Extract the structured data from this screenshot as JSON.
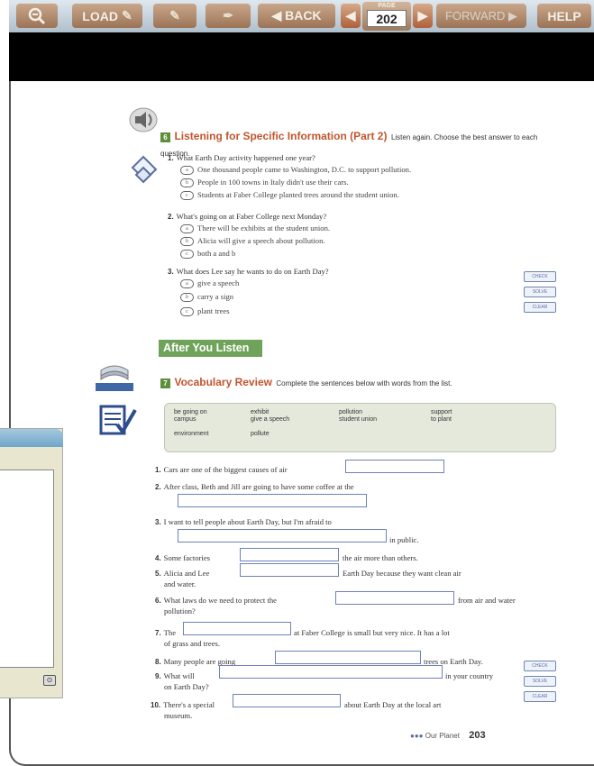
{
  "toolbar": {
    "zoom_icon": "magnifier-icon",
    "load_label": "LOAD",
    "back_label": "◀ BACK",
    "page_caption": "PAGE",
    "page_number": "202",
    "forward_label": "FORWARD ▶",
    "help_label": "HELP"
  },
  "section6": {
    "number": "6",
    "title": "Listening for Specific Information (Part 2)",
    "instruction": "Listen again. Choose the best answer to each question.",
    "questions": [
      {
        "num": "1.",
        "text": "What Earth Day activity happened one year?",
        "options": [
          {
            "letter": "a",
            "text": "One thousand people came to Washington, D.C. to support pollution."
          },
          {
            "letter": "b",
            "text": "People in 100 towns in Italy didn't use their cars."
          },
          {
            "letter": "c",
            "text": "Students at Faber College planted trees around the student union."
          }
        ]
      },
      {
        "num": "2.",
        "text": "What's going on at Faber College next Monday?",
        "options": [
          {
            "letter": "a",
            "text": "There will be exhibits at the student union."
          },
          {
            "letter": "b",
            "text": "Alicia will give a speech about pollution."
          },
          {
            "letter": "c",
            "text": "both a and b"
          }
        ]
      },
      {
        "num": "3.",
        "text": "What does Lee say he wants to do on Earth Day?",
        "options": [
          {
            "letter": "a",
            "text": "give a speech"
          },
          {
            "letter": "b",
            "text": "carry a sign"
          },
          {
            "letter": "c",
            "text": "plant trees"
          }
        ]
      }
    ]
  },
  "side_buttons": {
    "check": "CHECK",
    "solve": "SOLVE",
    "clear": "CLEAR"
  },
  "after_you_listen": "After You Listen",
  "section7": {
    "number": "7",
    "title": "Vocabulary Review",
    "instruction": "Complete the sentences below with words from the list.",
    "words": [
      "be going on",
      "campus",
      "environment",
      "exhibit",
      "give a speech",
      "pollute",
      "pollution",
      "student union",
      "support",
      "to plant"
    ],
    "sentences": [
      {
        "num": "1.",
        "a": "Cars are one of the biggest causes of air",
        "b": ""
      },
      {
        "num": "2.",
        "a": "After class, Beth and Jill are going to have some coffee at the",
        "b": ""
      },
      {
        "num": "3.",
        "a": "I want to tell people about Earth Day, but I'm afraid to",
        "b": "in public."
      },
      {
        "num": "4.",
        "a": "Some factories",
        "b": "the air more than others."
      },
      {
        "num": "5.",
        "a": "Alicia and Lee",
        "b": "Earth Day because they want clean air",
        "c": "and water."
      },
      {
        "num": "6.",
        "a": "What laws do we need to protect the",
        "b": "from air and water",
        "c": "pollution?"
      },
      {
        "num": "7.",
        "a": "The",
        "b": "at Faber College is small but very nice. It has a lot",
        "c": "of grass and trees."
      },
      {
        "num": "8.",
        "a": "Many people are going",
        "b": "trees on Earth Day."
      },
      {
        "num": "9.",
        "a": "What will",
        "b": "in your country",
        "c": "on Earth Day?"
      },
      {
        "num": "10.",
        "a": "There's a special",
        "b": "about Earth Day at the local art",
        "c": "museum."
      }
    ]
  },
  "footer": {
    "text": "Our Planet",
    "page": "203"
  }
}
